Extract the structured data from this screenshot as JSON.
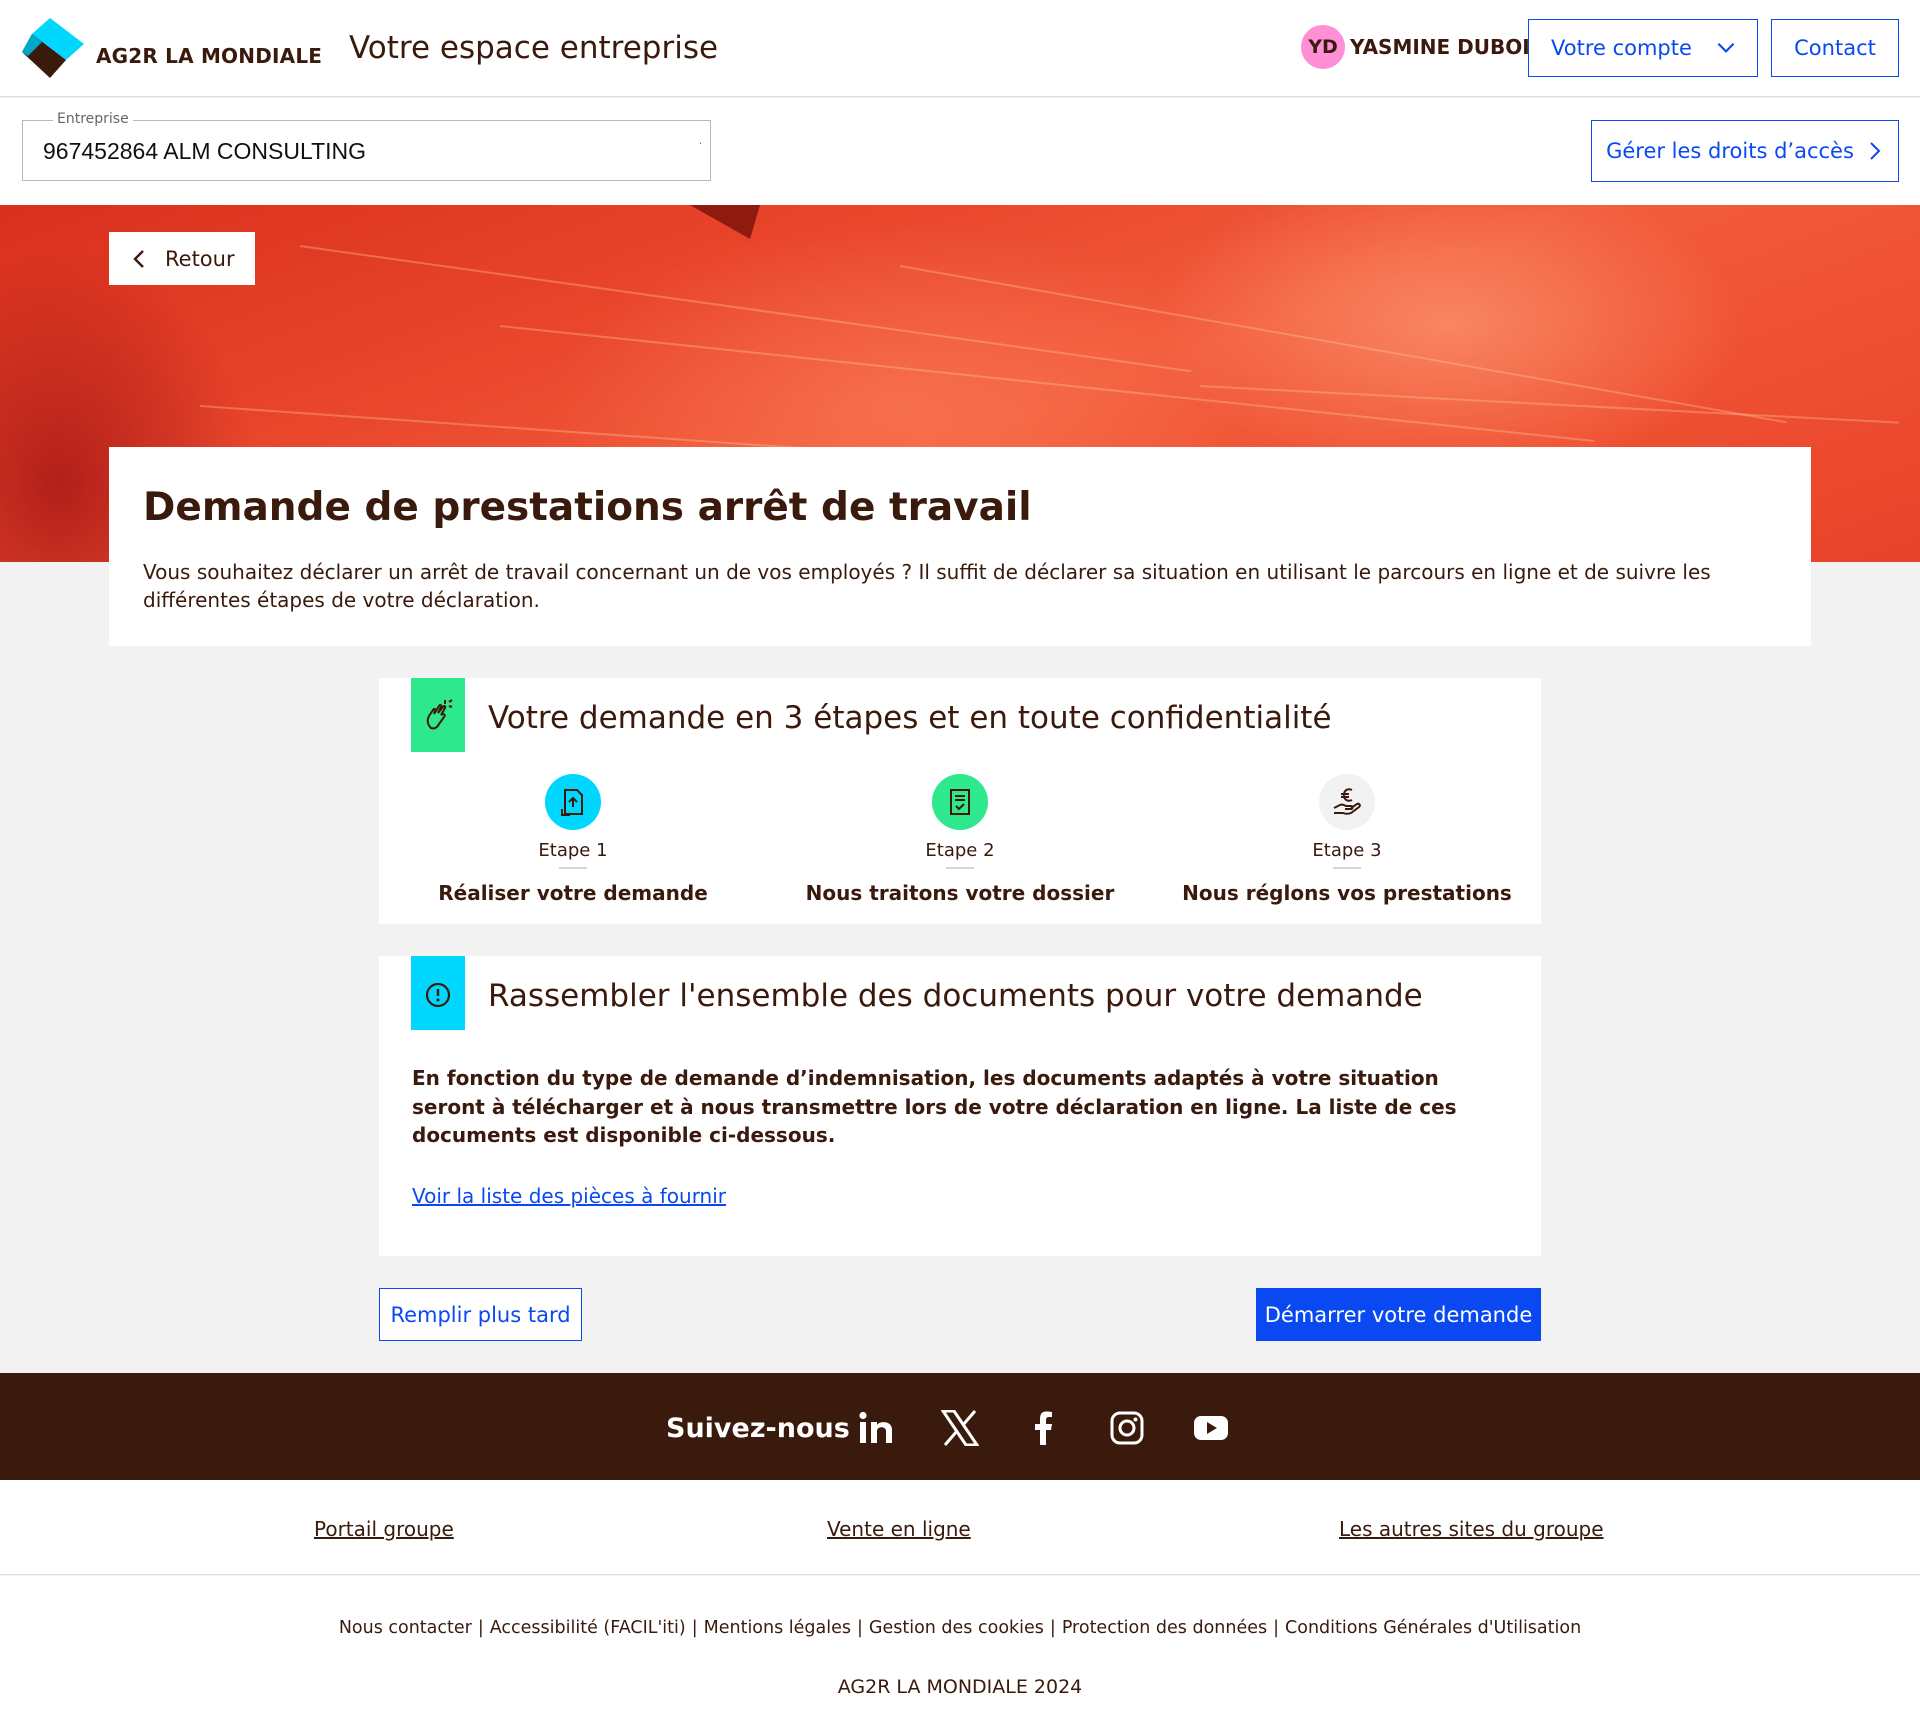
{
  "header": {
    "brand": "AG2R LA MONDIALE",
    "subtitle": "Votre espace entreprise",
    "user_initials": "YD",
    "user_name": "YASMINE DUBOIS",
    "account_label": "Votre compte",
    "contact_label": "Contact"
  },
  "enterprise": {
    "label": "Entreprise",
    "value": "967452864 ALM CONSULTING",
    "rights_label": "Gérer les droits d’accès"
  },
  "hero": {
    "back_label": "Retour"
  },
  "intro": {
    "title": "Demande de prestations arrêt de travail",
    "description": "Vous souhaitez déclarer un arrêt de travail concernant un de vos employés ? Il suffit de déclarer sa situation en utilisant le parcours en ligne et de suivre les différentes étapes de votre déclaration."
  },
  "steps_card": {
    "title": "Votre demande en 3 étapes et en toute confidentialité",
    "steps": [
      {
        "num": "Etape 1",
        "label": "Réaliser votre demande",
        "icon": "document-upload-icon",
        "color": "#00d7ff"
      },
      {
        "num": "Etape 2",
        "label": "Nous traitons votre dossier",
        "icon": "checklist-icon",
        "color": "#2ee88e"
      },
      {
        "num": "Etape 3",
        "label": "Nous réglons vos prestations",
        "icon": "euro-hand-icon",
        "color": "#f2f2f2"
      }
    ]
  },
  "docs_card": {
    "title": "Rassembler l'ensemble des documents pour votre demande",
    "text": "En fonction du type de demande d’indemnisation, les documents adaptés à votre situation seront à télécharger et à nous transmettre lors de votre déclaration en ligne. La liste de ces documents est disponible ci-dessous.",
    "link": "Voir la liste des pièces à fournir"
  },
  "actions": {
    "later": "Remplir plus tard",
    "start": "Démarrer votre demande"
  },
  "follow": {
    "label": "Suivez-nous",
    "networks": [
      "linkedin-icon",
      "x-icon",
      "facebook-icon",
      "instagram-icon",
      "youtube-icon"
    ]
  },
  "footer": {
    "links": [
      "Portail groupe",
      "Vente en ligne",
      "Les autres sites du groupe"
    ],
    "legal": [
      "Nous contacter",
      "Accessibilité (FACIL'iti)",
      "Mentions légales",
      "Gestion des cookies",
      "Protection des données",
      "Conditions Générales d'Utilisation"
    ],
    "copyright": "AG2R LA MONDIALE 2024"
  },
  "colors": {
    "primary": "#0a49f2",
    "brown": "#3a1a0c",
    "cyan": "#00d7ff",
    "green": "#2ee88e",
    "avatar": "#ff8fd6"
  }
}
